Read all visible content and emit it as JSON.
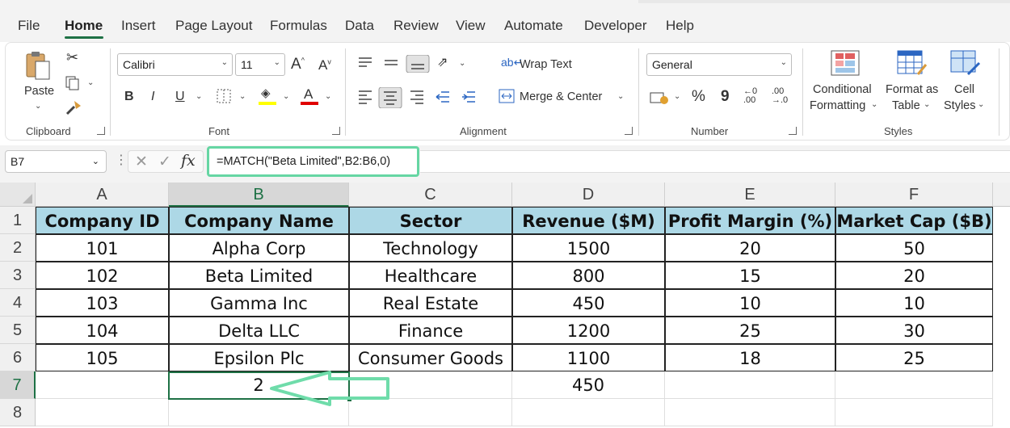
{
  "menu": {
    "tabs": [
      "File",
      "Home",
      "Insert",
      "Page Layout",
      "Formulas",
      "Data",
      "Review",
      "View",
      "Automate",
      "Developer",
      "Help"
    ],
    "active": "Home"
  },
  "ribbon": {
    "clipboard": {
      "paste_label": "Paste",
      "group_label": "Clipboard"
    },
    "font": {
      "font_name": "Calibri",
      "font_size": "11",
      "bold": "B",
      "italic": "I",
      "underline": "U",
      "group_label": "Font",
      "font_color": "#e00000",
      "highlight_color": "#ffff00"
    },
    "alignment": {
      "wrap_text": "Wrap Text",
      "merge_center": "Merge & Center",
      "group_label": "Alignment"
    },
    "number": {
      "format": "General",
      "percent": "%",
      "comma": "9",
      "group_label": "Number"
    },
    "styles": {
      "conditional_line1": "Conditional",
      "conditional_line2": "Formatting",
      "format_table_line1": "Format as",
      "format_table_line2": "Table",
      "cell_styles_line1": "Cell",
      "cell_styles_line2": "Styles",
      "group_label": "Styles"
    }
  },
  "formula_bar": {
    "name_box": "B7",
    "fx": "fx",
    "formula": "=MATCH(\"Beta Limited\",B2:B6,0)",
    "highlight_color": "#66d6a3"
  },
  "sheet": {
    "columns": [
      "A",
      "B",
      "C",
      "D",
      "E",
      "F"
    ],
    "rows": [
      "1",
      "2",
      "3",
      "4",
      "5",
      "6",
      "7",
      "8"
    ],
    "selected_cell": "B7",
    "header_fill": "#add8e6",
    "headers": [
      "Company ID",
      "Company Name",
      "Sector",
      "Revenue ($M)",
      "Profit Margin (%)",
      "Market Cap ($B)"
    ],
    "data": [
      [
        "101",
        "Alpha Corp",
        "Technology",
        "1500",
        "20",
        "50"
      ],
      [
        "102",
        "Beta Limited",
        "Healthcare",
        "800",
        "15",
        "20"
      ],
      [
        "103",
        "Gamma Inc",
        "Real Estate",
        "450",
        "10",
        "10"
      ],
      [
        "104",
        "Delta LLC",
        "Finance",
        "1200",
        "25",
        "30"
      ],
      [
        "105",
        "Epsilon Plc",
        "Consumer Goods",
        "1100",
        "18",
        "25"
      ]
    ],
    "row7": {
      "B": "2",
      "D": "450"
    },
    "arrow_color": "#6fdcaa"
  }
}
